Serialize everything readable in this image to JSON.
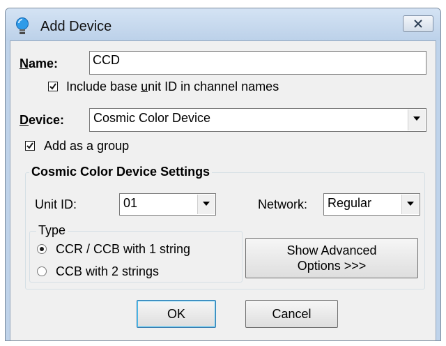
{
  "window": {
    "title": "Add Device"
  },
  "name_field": {
    "label_prefix": "",
    "label_mnemonic": "N",
    "label_rest": "ame:",
    "value": "CCD"
  },
  "include_base_unit": {
    "label_pre": "Include base ",
    "label_mnemonic": "u",
    "label_rest": "nit ID in channel names",
    "checked": true
  },
  "device_field": {
    "label_mnemonic": "D",
    "label_rest": "evice:",
    "value": "Cosmic Color Device"
  },
  "add_as_group": {
    "label_pre": "Add as a ",
    "label_mnemonic": "g",
    "label_rest": "roup",
    "checked": true
  },
  "settings": {
    "title": "Cosmic Color Device Settings",
    "unit_id": {
      "label": "Unit ID:",
      "value": "01"
    },
    "network": {
      "label": "Network:",
      "value": "Regular"
    },
    "type": {
      "title": "Type",
      "options": [
        {
          "label": "CCR / CCB with 1 string",
          "selected": true
        },
        {
          "label": "CCB with 2 strings",
          "selected": false
        }
      ]
    },
    "advanced_button": {
      "line1": "Show Advanced",
      "line2": "Options >>>"
    }
  },
  "buttons": {
    "ok": "OK",
    "cancel": "Cancel"
  }
}
